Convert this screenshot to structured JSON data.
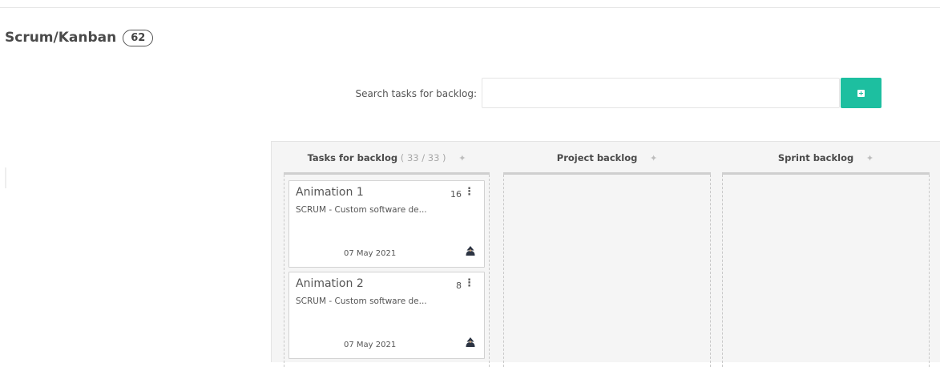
{
  "header": {
    "title": "Scrum/Kanban",
    "count": "62"
  },
  "search": {
    "label": "Search tasks for backlog:",
    "value": "",
    "placeholder": ""
  },
  "columns": [
    {
      "title": "Tasks for backlog",
      "count": "( 33 / 33 )",
      "add_symbol": "✦"
    },
    {
      "title": "Project backlog",
      "add_symbol": "✦"
    },
    {
      "title": "Sprint backlog",
      "add_symbol": "✦"
    }
  ],
  "cards": [
    {
      "title": "Animation 1",
      "points": "16",
      "menu": "⋮",
      "project": "SCRUM - Custom software de...",
      "date": "07 May 2021",
      "avatar_icon": "user-avatar-icon"
    },
    {
      "title": "Animation 2",
      "points": "8",
      "menu": "⋮",
      "project": "SCRUM - Custom software de...",
      "date": "07 May 2021",
      "avatar_icon": "user-avatar-icon"
    }
  ],
  "colors": {
    "accent": "#1dbfa0",
    "board_bg": "#f5f5f5",
    "column_bar": "#cfcfcf"
  }
}
